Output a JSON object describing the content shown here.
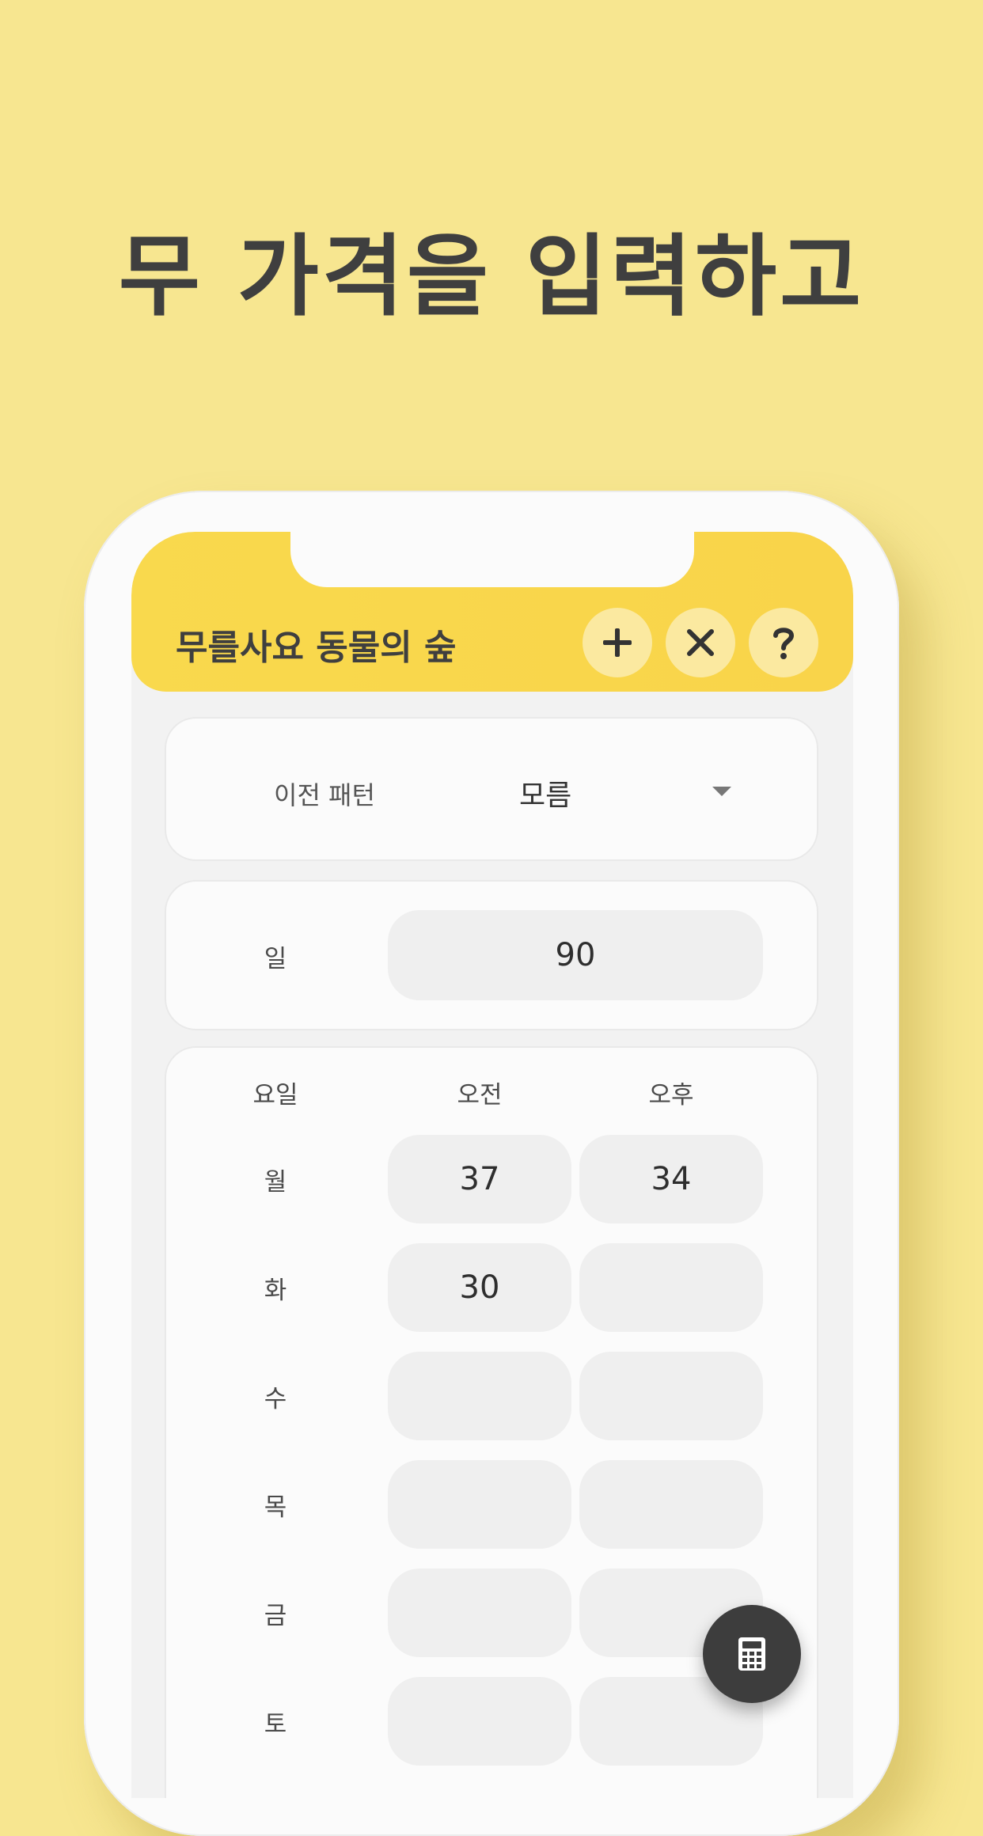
{
  "headline": "무 가격을 입력하고",
  "app": {
    "title": "무를사요 동물의 숲",
    "buttons": {
      "add": "plus-icon",
      "clear": "close-icon",
      "help": "help-icon"
    }
  },
  "pattern": {
    "label": "이전 패턴",
    "value": "모름"
  },
  "sunday": {
    "label": "일",
    "value": "90"
  },
  "table": {
    "headers": [
      "요일",
      "오전",
      "오후"
    ],
    "rows": [
      {
        "day": "월",
        "am": "37",
        "pm": "34"
      },
      {
        "day": "화",
        "am": "30",
        "pm": ""
      },
      {
        "day": "수",
        "am": "",
        "pm": ""
      },
      {
        "day": "목",
        "am": "",
        "pm": ""
      },
      {
        "day": "금",
        "am": "",
        "pm": ""
      },
      {
        "day": "토",
        "am": "",
        "pm": ""
      }
    ]
  },
  "fab": {
    "icon": "calculator-icon"
  },
  "colors": {
    "background": "#f7e690",
    "appbar": "#f9d94d",
    "button": "#fbe9a0",
    "fab": "#3d3d3d"
  }
}
